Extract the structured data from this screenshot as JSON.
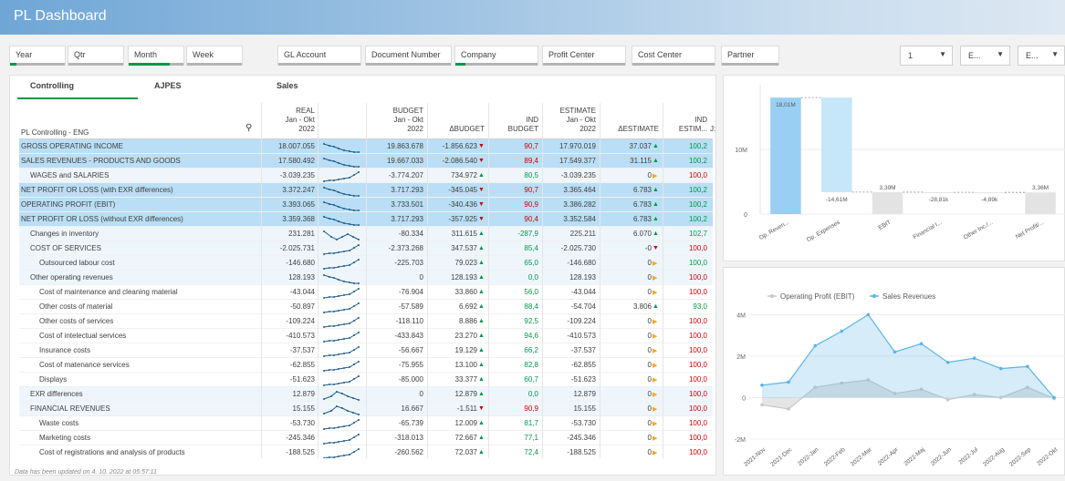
{
  "app": {
    "title": "PL Dashboard"
  },
  "filters": [
    {
      "label": "Year",
      "bar": "green-half"
    },
    {
      "label": "Qtr",
      "bar": "gray"
    },
    {
      "label": "Month",
      "bar": "green-full"
    },
    {
      "label": "Week",
      "bar": "gray"
    },
    {
      "label": "GL Account",
      "bar": "gray"
    },
    {
      "label": "Document Number",
      "bar": "gray"
    },
    {
      "label": "Company",
      "bar": "green-half"
    },
    {
      "label": "Profit Center",
      "bar": "gray"
    },
    {
      "label": "Cost Center",
      "bar": "gray"
    },
    {
      "label": "Partner",
      "bar": "gray"
    }
  ],
  "selectors": [
    {
      "value": "1"
    },
    {
      "value": "E..."
    },
    {
      "value": "E..."
    }
  ],
  "tabs": [
    {
      "label": "Controlling",
      "active": true
    },
    {
      "label": "AJPES"
    },
    {
      "label": "Sales"
    }
  ],
  "table": {
    "title": "PL Controlling - ENG",
    "headers": {
      "real": [
        "REAL",
        "Jan - Okt",
        "2022"
      ],
      "budget": [
        "BUDGET",
        "Jan - Okt",
        "2022"
      ],
      "dbudget": "ΔBUDGET",
      "indbudget": [
        "IND",
        "BUDGET"
      ],
      "estimate": [
        "ESTIMATE",
        "Jan - Okt",
        "2022"
      ],
      "destimate": "ΔESTIMATE",
      "indestimate": [
        "IND",
        "ESTIM..."
      ],
      "extra": "J:"
    },
    "rows": [
      {
        "name": "GROSS OPERATING INCOME",
        "level": 0,
        "style": "hl",
        "real": "18.007.055",
        "budget": "19.863.678",
        "dbudget": "-1.856.623",
        "db": "dn",
        "ib": "90,7",
        "ibc": "r",
        "est": "17.970.019",
        "dest": "37.037",
        "de": "up",
        "ie": "100,2",
        "iec": "g",
        "spark": "down"
      },
      {
        "name": "SALES REVENUES - PRODUCTS AND GOODS",
        "level": 0,
        "style": "hl",
        "real": "17.580.492",
        "budget": "19.667.033",
        "dbudget": "-2.086.540",
        "db": "dn",
        "ib": "89,4",
        "ibc": "r",
        "est": "17.549.377",
        "dest": "31.115",
        "de": "up",
        "ie": "100,2",
        "iec": "g",
        "spark": "down"
      },
      {
        "name": "WAGES and SALARIES",
        "level": 1,
        "style": "sub",
        "real": "-3.039.235",
        "budget": "-3.774.207",
        "dbudget": "734.972",
        "db": "up",
        "ib": "80,5",
        "ibc": "g",
        "est": "-3.039.235",
        "dest": "0",
        "de": "eq",
        "ie": "100,0",
        "iec": "r",
        "spark": "up"
      },
      {
        "name": "NET PROFIT OR LOSS (with EXR differences)",
        "level": 0,
        "style": "hl",
        "real": "3.372.247",
        "budget": "3.717.293",
        "dbudget": "-345.045",
        "db": "dn",
        "ib": "90,7",
        "ibc": "r",
        "est": "3.365.464",
        "dest": "6.783",
        "de": "up",
        "ie": "100,2",
        "iec": "g",
        "spark": "down"
      },
      {
        "name": "OPERATING PROFIT (EBIT)",
        "level": 0,
        "style": "hl",
        "real": "3.393.065",
        "budget": "3.733.501",
        "dbudget": "-340.436",
        "db": "dn",
        "ib": "90,9",
        "ibc": "r",
        "est": "3.386.282",
        "dest": "6.783",
        "de": "up",
        "ie": "100,2",
        "iec": "g",
        "spark": "down"
      },
      {
        "name": "NET PROFIT OR LOSS (without EXR differences)",
        "level": 0,
        "style": "hl",
        "real": "3.359.368",
        "budget": "3.717.293",
        "dbudget": "-357.925",
        "db": "dn",
        "ib": "90,4",
        "ibc": "r",
        "est": "3.352.584",
        "dest": "6.783",
        "de": "up",
        "ie": "100,2",
        "iec": "g",
        "spark": "down"
      },
      {
        "name": "Changes in inventory",
        "level": 1,
        "style": "sub",
        "real": "231.281",
        "budget": "-80.334",
        "dbudget": "311.615",
        "db": "up",
        "ib": "-287,9",
        "ibc": "g",
        "est": "225.211",
        "dest": "6.070",
        "de": "up",
        "ie": "102,7",
        "iec": "g",
        "spark": "vee"
      },
      {
        "name": "COST OF SERVICES",
        "level": 1,
        "style": "sub",
        "real": "-2.025.731",
        "budget": "-2.373.268",
        "dbudget": "347.537",
        "db": "up",
        "ib": "85,4",
        "ibc": "g",
        "est": "-2.025.730",
        "dest": "-0",
        "de": "dn",
        "ie": "100,0",
        "iec": "r",
        "spark": "up"
      },
      {
        "name": "Outsourced labour cost",
        "level": 2,
        "style": "sub",
        "real": "-146.680",
        "budget": "-225.703",
        "dbudget": "79.023",
        "db": "up",
        "ib": "65,0",
        "ibc": "g",
        "est": "-146.680",
        "dest": "0",
        "de": "eq",
        "ie": "100,0",
        "iec": "g",
        "spark": "up"
      },
      {
        "name": "Other operating revenues",
        "level": 1,
        "style": "sub",
        "real": "128.193",
        "budget": "0",
        "dbudget": "128.193",
        "db": "up",
        "ib": "0,0",
        "ibc": "g",
        "est": "128.193",
        "dest": "0",
        "de": "eq",
        "ie": "100,0",
        "iec": "r",
        "spark": "down"
      },
      {
        "name": "Cost of maintenance and cleaning material",
        "level": 2,
        "style": "",
        "real": "-43.044",
        "budget": "-76.904",
        "dbudget": "33.860",
        "db": "up",
        "ib": "56,0",
        "ibc": "g",
        "est": "-43.044",
        "dest": "0",
        "de": "eq",
        "ie": "100,0",
        "iec": "r",
        "spark": "up"
      },
      {
        "name": "Other costs of material",
        "level": 2,
        "style": "",
        "real": "-50.897",
        "budget": "-57.589",
        "dbudget": "6.692",
        "db": "up",
        "ib": "88,4",
        "ibc": "g",
        "est": "-54.704",
        "dest": "3.806",
        "de": "up",
        "ie": "93,0",
        "iec": "g",
        "spark": "up"
      },
      {
        "name": "Other costs of services",
        "level": 2,
        "style": "",
        "real": "-109.224",
        "budget": "-118.110",
        "dbudget": "8.886",
        "db": "up",
        "ib": "92,5",
        "ibc": "g",
        "est": "-109.224",
        "dest": "0",
        "de": "eq",
        "ie": "100,0",
        "iec": "r",
        "spark": "up"
      },
      {
        "name": "Cost of intelectual services",
        "level": 2,
        "style": "",
        "real": "-410.573",
        "budget": "-433.843",
        "dbudget": "23.270",
        "db": "up",
        "ib": "94,6",
        "ibc": "g",
        "est": "-410.573",
        "dest": "0",
        "de": "eq",
        "ie": "100,0",
        "iec": "r",
        "spark": "up"
      },
      {
        "name": "Insurance costs",
        "level": 2,
        "style": "",
        "real": "-37.537",
        "budget": "-56.667",
        "dbudget": "19.129",
        "db": "up",
        "ib": "66,2",
        "ibc": "g",
        "est": "-37.537",
        "dest": "0",
        "de": "eq",
        "ie": "100,0",
        "iec": "r",
        "spark": "up"
      },
      {
        "name": "Cost of matenance services",
        "level": 2,
        "style": "",
        "real": "-62.855",
        "budget": "-75.955",
        "dbudget": "13.100",
        "db": "up",
        "ib": "82,8",
        "ibc": "g",
        "est": "-62.855",
        "dest": "0",
        "de": "eq",
        "ie": "100,0",
        "iec": "r",
        "spark": "up"
      },
      {
        "name": "Displays",
        "level": 2,
        "style": "",
        "real": "-51.623",
        "budget": "-85.000",
        "dbudget": "33.377",
        "db": "up",
        "ib": "60,7",
        "ibc": "g",
        "est": "-51.623",
        "dest": "0",
        "de": "eq",
        "ie": "100,0",
        "iec": "r",
        "spark": "up"
      },
      {
        "name": "EXR differences",
        "level": 1,
        "style": "sub",
        "real": "12.879",
        "budget": "0",
        "dbudget": "12.879",
        "db": "up",
        "ib": "0,0",
        "ibc": "g",
        "est": "12.879",
        "dest": "0",
        "de": "eq",
        "ie": "100,0",
        "iec": "r",
        "spark": "peak"
      },
      {
        "name": "FINANCIAL REVENUES",
        "level": 1,
        "style": "sub",
        "real": "15.155",
        "budget": "16.667",
        "dbudget": "-1.511",
        "db": "dn",
        "ib": "90,9",
        "ibc": "r",
        "est": "15.155",
        "dest": "0",
        "de": "eq",
        "ie": "100,0",
        "iec": "r",
        "spark": "peak"
      },
      {
        "name": "Waste costs",
        "level": 2,
        "style": "",
        "real": "-53.730",
        "budget": "-65.739",
        "dbudget": "12.009",
        "db": "up",
        "ib": "81,7",
        "ibc": "g",
        "est": "-53.730",
        "dest": "0",
        "de": "eq",
        "ie": "100,0",
        "iec": "r",
        "spark": "up"
      },
      {
        "name": "Marketing costs",
        "level": 2,
        "style": "",
        "real": "-245.346",
        "budget": "-318.013",
        "dbudget": "72.667",
        "db": "up",
        "ib": "77,1",
        "ibc": "g",
        "est": "-245.346",
        "dest": "0",
        "de": "eq",
        "ie": "100,0",
        "iec": "r",
        "spark": "up"
      },
      {
        "name": "Cost of registrations and analysis of products",
        "level": 2,
        "style": "",
        "real": "-188.525",
        "budget": "-260.562",
        "dbudget": "72.037",
        "db": "up",
        "ib": "72,4",
        "ibc": "g",
        "est": "-188.525",
        "dest": "0",
        "de": "eq",
        "ie": "100,0",
        "iec": "r",
        "spark": "up"
      }
    ]
  },
  "footer": "Data has been updated on 4. 10. 2022 at 05:57:11",
  "chart_data": [
    {
      "type": "bar",
      "subtype": "waterfall",
      "categories": [
        "Op. Reven...",
        "Op. Expenses",
        "EBIT",
        "Financial I...",
        "Other Inc./...",
        "Net Profit/..."
      ],
      "values": [
        18.01,
        -14.61,
        3.39,
        -0.02881,
        -0.00489,
        3.36
      ],
      "data_labels": [
        "18,01M",
        "-14,61M",
        "3,39M",
        "-28,81k",
        "-4,89k",
        "3,36M"
      ],
      "unit": "M",
      "yticks": [
        "10M",
        "0"
      ],
      "ylim": [
        0,
        20
      ],
      "colors": {
        "Op. Reven...": "#99cff2",
        "Op. Expenses": "#c6e6f9",
        "total": "#e3e3e3"
      },
      "grid": true
    },
    {
      "type": "area",
      "x": [
        "2021-Nov",
        "2021-Dec",
        "2022-Jan",
        "2022-Feb",
        "2022-Mar",
        "2022-Apr",
        "2022-Maj",
        "2022-Jun",
        "2022-Jul",
        "2022-Aug",
        "2022-Sep",
        "2022-Okt"
      ],
      "series": [
        {
          "name": "Operating Profit (EBIT)",
          "color": "#c8c8c8",
          "values": [
            -0.35,
            -0.55,
            0.5,
            0.7,
            0.85,
            0.2,
            0.4,
            -0.1,
            0.15,
            0.0,
            0.5,
            -0.05
          ]
        },
        {
          "name": "Sales Revenues",
          "color": "#5bb4e5",
          "values": [
            0.6,
            0.75,
            2.5,
            3.2,
            4.0,
            2.2,
            2.6,
            1.7,
            1.9,
            1.4,
            1.5,
            0.0
          ]
        }
      ],
      "yticks": [
        "4M",
        "2M",
        "0",
        "-2M"
      ],
      "ylim": [
        -2,
        4.5
      ],
      "legend": "top-left",
      "grid": true
    }
  ]
}
